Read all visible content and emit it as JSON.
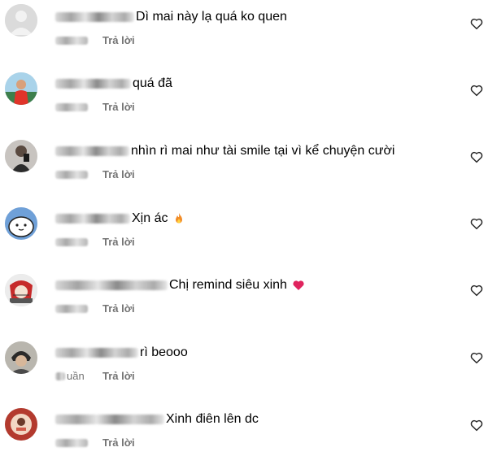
{
  "comments": [
    {
      "text": "Dì mai này lạ quá ko quen",
      "reply": "Trả lời",
      "time": ""
    },
    {
      "text": "quá đã",
      "reply": "Trả lời",
      "time": ""
    },
    {
      "text": "nhìn rì mai như tài smile tại vì kể chuyện cười",
      "reply": "Trả lời",
      "time": ""
    },
    {
      "text": "Xịn ác",
      "reply": "Trả lời",
      "time": "",
      "emoji": "fire-emoji"
    },
    {
      "text": "Chị remind siêu xinh",
      "reply": "Trả lời",
      "time": "",
      "emoji": "red-heart-emoji"
    },
    {
      "text": "rì beooo",
      "reply": "Trả lời",
      "time": "uần"
    },
    {
      "text": "Xinh điên lên dc",
      "reply": "Trả lời",
      "time": ""
    }
  ],
  "icons": {
    "like": "heart-outline-icon"
  },
  "colors": {
    "secondary_text": "#737373",
    "heart_emoji": "#e0245e",
    "fire_emoji": "#f28c28"
  }
}
